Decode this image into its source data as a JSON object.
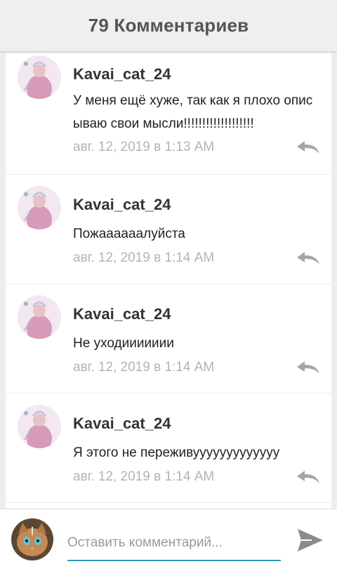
{
  "header": {
    "title": "79 Комментариев"
  },
  "comments": [
    {
      "author": "Kavai_cat_24",
      "text": "У меня ещё хуже, так как я плохо описываю свои мысли!!!!!!!!!!!!!!!!!!!",
      "date": "авг. 12, 2019 в 1:13 AM"
    },
    {
      "author": "Kavai_cat_24",
      "text": "Пожаааааалуйста",
      "date": "авг. 12, 2019 в 1:14 AM"
    },
    {
      "author": "Kavai_cat_24",
      "text": "Не уходиииииии",
      "date": "авг. 12, 2019 в 1:14 AM"
    },
    {
      "author": "Kavai_cat_24",
      "text": "Я этого не переживууууууууууууу",
      "date": "авг. 12, 2019 в 1:14 AM"
    }
  ],
  "composer": {
    "placeholder": "Оставить комментарий..."
  },
  "colors": {
    "accent": "#2a9ab6",
    "reply_icon": "#a6a6a6",
    "send_icon": "#8a8a8a"
  },
  "icons": {
    "reply": "reply-icon",
    "send": "send-icon"
  }
}
